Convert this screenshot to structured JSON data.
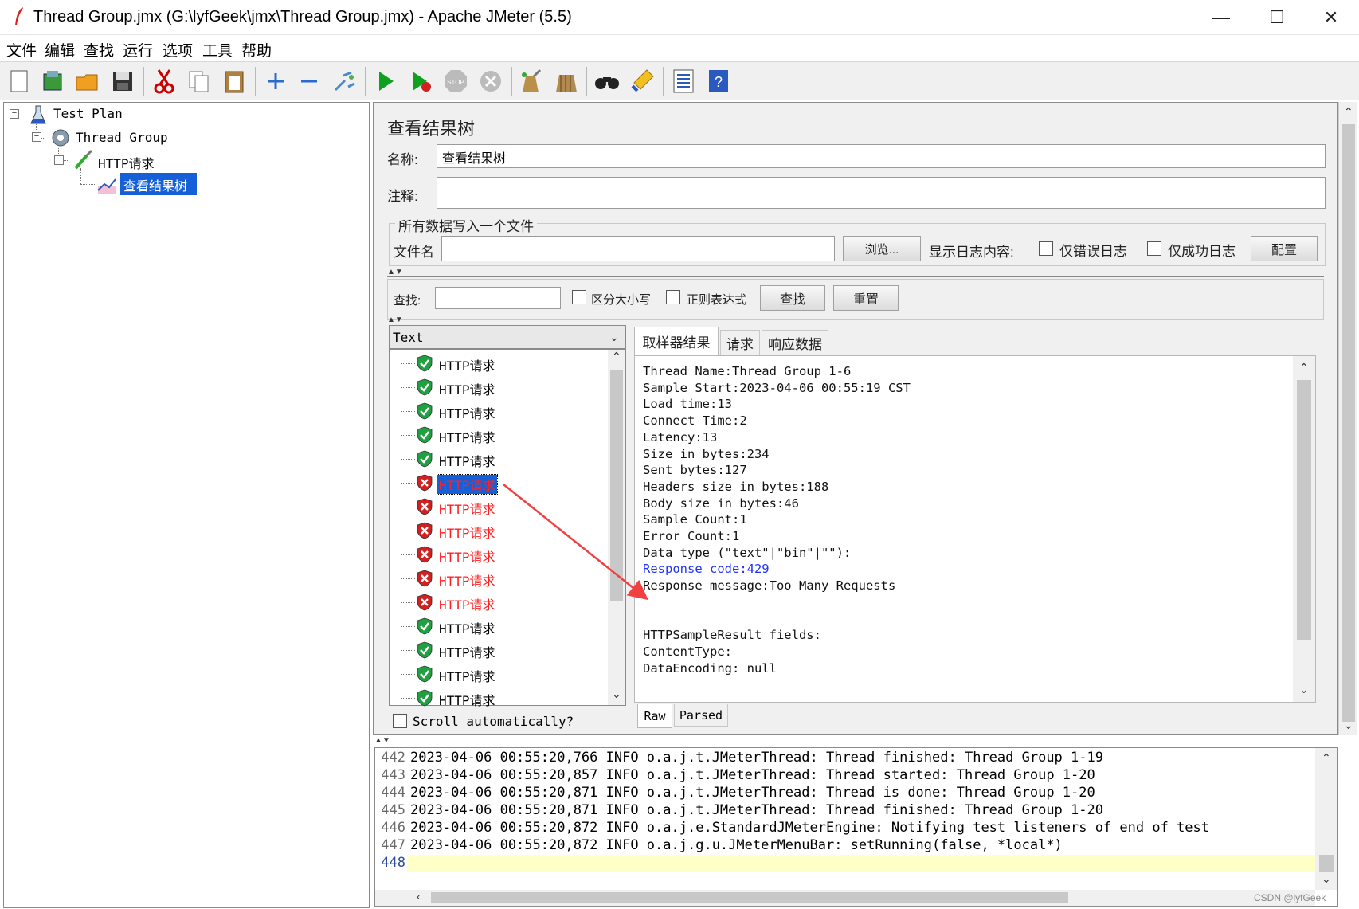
{
  "window": {
    "title": "Thread Group.jmx (G:\\lyfGeek\\jmx\\Thread Group.jmx) - Apache JMeter (5.5)",
    "minimize": "—",
    "maximize": "☐",
    "close": "✕"
  },
  "menu": [
    "文件",
    "编辑",
    "查找",
    "运行",
    "选项",
    "工具",
    "帮助"
  ],
  "toolbar": {
    "icons": [
      "new-icon",
      "templates-icon",
      "open-icon",
      "save-icon",
      "cut-icon",
      "copy-icon",
      "paste-icon",
      "expand-icon",
      "collapse-icon",
      "toggle-icon",
      "start-icon",
      "start-no-pause-icon",
      "stop-icon",
      "shutdown-icon",
      "clear-icon",
      "clear-all-icon",
      "search-icon",
      "reset-search-icon",
      "function-helper-icon",
      "help-icon"
    ]
  },
  "tree": {
    "test_plan": "Test Plan",
    "thread_group": "Thread Group",
    "http_request": "HTTP请求",
    "listener": "查看结果树"
  },
  "panel": {
    "heading": "查看结果树",
    "name_label": "名称:",
    "name_value": "查看结果树",
    "comment_label": "注释:",
    "comment_value": "",
    "file_section": "所有数据写入一个文件",
    "filename_label": "文件名",
    "filename_value": "",
    "browse_button": "浏览...",
    "log_content_label": "显示日志内容:",
    "errors_only": "仅错误日志",
    "success_only": "仅成功日志",
    "configure_button": "配置",
    "search_label": "查找:",
    "search_value": "",
    "case_sensitive": "区分大小写",
    "regex": "正则表达式",
    "search_button": "查找",
    "reset_button": "重置",
    "renderer": "Text",
    "scroll_auto": "Scroll automatically?"
  },
  "results": [
    {
      "label": "HTTP请求",
      "status": "success"
    },
    {
      "label": "HTTP请求",
      "status": "success"
    },
    {
      "label": "HTTP请求",
      "status": "success"
    },
    {
      "label": "HTTP请求",
      "status": "success"
    },
    {
      "label": "HTTP请求",
      "status": "success"
    },
    {
      "label": "HTTP请求",
      "status": "error",
      "selected": true
    },
    {
      "label": "HTTP请求",
      "status": "error"
    },
    {
      "label": "HTTP请求",
      "status": "error"
    },
    {
      "label": "HTTP请求",
      "status": "error"
    },
    {
      "label": "HTTP请求",
      "status": "error"
    },
    {
      "label": "HTTP请求",
      "status": "error"
    },
    {
      "label": "HTTP请求",
      "status": "success"
    },
    {
      "label": "HTTP请求",
      "status": "success"
    },
    {
      "label": "HTTP请求",
      "status": "success"
    },
    {
      "label": "HTTP请求",
      "status": "success"
    }
  ],
  "detail_tabs": [
    "取样器结果",
    "请求",
    "响应数据"
  ],
  "detail_lines": [
    "Thread Name:Thread Group 1-6",
    "Sample Start:2023-04-06 00:55:19 CST",
    "Load time:13",
    "Connect Time:2",
    "Latency:13",
    "Size in bytes:234",
    "Sent bytes:127",
    "Headers size in bytes:188",
    "Body size in bytes:46",
    "Sample Count:1",
    "Error Count:1",
    "Data type (\"text\"|\"bin\"|\"\"):",
    "Response code:429",
    "Response message:Too Many Requests",
    "",
    "",
    "HTTPSampleResult fields:",
    "ContentType:",
    "DataEncoding: null"
  ],
  "view_tabs": [
    "Raw",
    "Parsed"
  ],
  "log": {
    "line_numbers": [
      "442",
      "443",
      "444",
      "445",
      "446",
      "447",
      "448"
    ],
    "lines": [
      "2023-04-06 00:55:20,766 INFO o.a.j.t.JMeterThread: Thread finished: Thread Group 1-19",
      "2023-04-06 00:55:20,857 INFO o.a.j.t.JMeterThread: Thread started: Thread Group 1-20",
      "2023-04-06 00:55:20,871 INFO o.a.j.t.JMeterThread: Thread is done: Thread Group 1-20",
      "2023-04-06 00:55:20,871 INFO o.a.j.t.JMeterThread: Thread finished: Thread Group 1-20",
      "2023-04-06 00:55:20,872 INFO o.a.j.e.StandardJMeterEngine: Notifying test listeners of end of test",
      "2023-04-06 00:55:20,872 INFO o.a.j.g.u.JMeterMenuBar: setRunning(false, *local*)",
      ""
    ]
  },
  "watermark": "CSDN @lyfGeek",
  "colors": {
    "selection": "#1560d8",
    "error": "#ff2020",
    "success": "#000000",
    "link": "#2233ff",
    "arrow": "#f04040",
    "log_highlight": "#ffffc8"
  }
}
